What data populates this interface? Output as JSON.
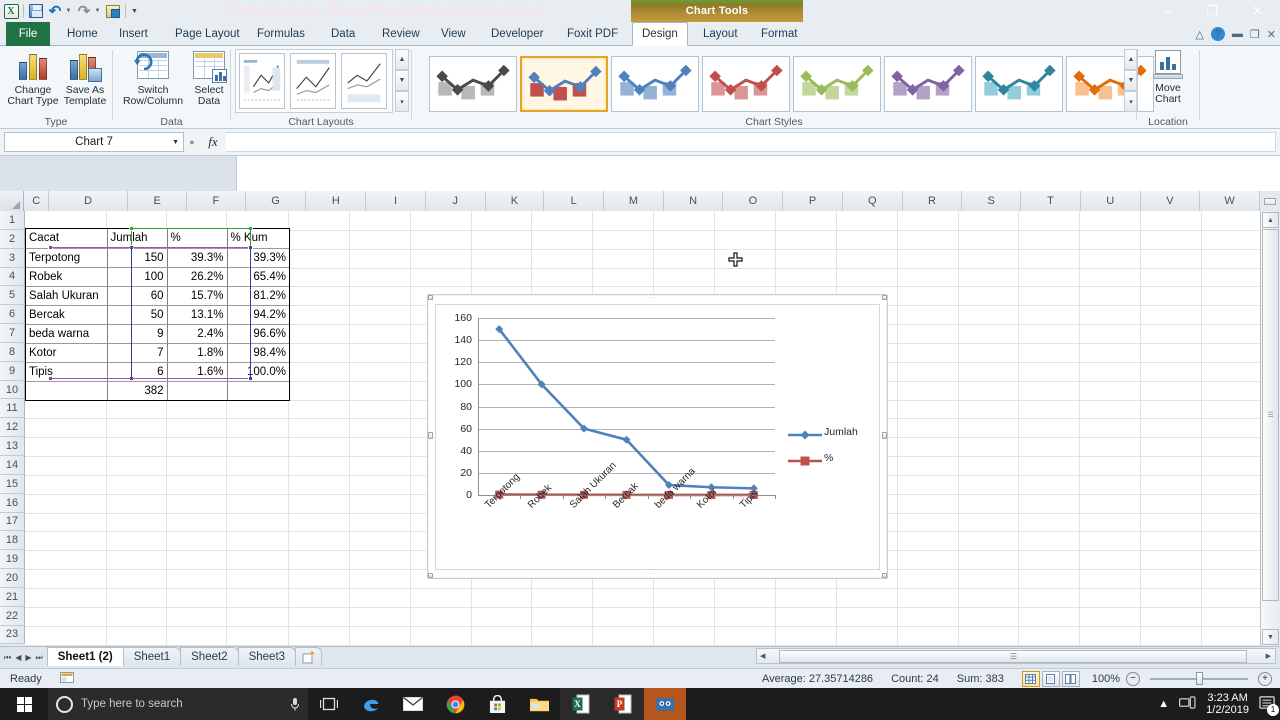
{
  "window": {
    "title": "Pareto Chart.xlsx  -  Microsoft Excel (Product Activation Failed)",
    "contextual_tab_group": "Chart Tools",
    "minimize": "–",
    "restore": "❐",
    "close": "✕",
    "accent_red": "#e81123",
    "excel_green": "#217346"
  },
  "quick_access": {
    "app_icon": "X",
    "items": [
      "save-icon",
      "undo-icon",
      "redo-icon",
      "print-preview-icon",
      "customize-qat-icon"
    ]
  },
  "ribbon": {
    "tabs": [
      "File",
      "Home",
      "Insert",
      "Page Layout",
      "Formulas",
      "Data",
      "Review",
      "View",
      "Developer",
      "Foxit PDF"
    ],
    "contextual_tabs": [
      "Design",
      "Layout",
      "Format"
    ],
    "active_tab": "Design",
    "help_icons": [
      "minimize-ribbon-icon",
      "help-icon",
      "restore-window-icon",
      "minimize-window-icon",
      "close-window-icon"
    ],
    "groups": [
      {
        "name": "Type",
        "buttons": [
          {
            "label_line1": "Change",
            "label_line2": "Chart Type",
            "icon": "change-chart-type-icon"
          },
          {
            "label_line1": "Save As",
            "label_line2": "Template",
            "icon": "save-as-template-icon"
          }
        ]
      },
      {
        "name": "Data",
        "buttons": [
          {
            "label_line1": "Switch",
            "label_line2": "Row/Column",
            "icon": "switch-row-column-icon"
          },
          {
            "label_line1": "Select",
            "label_line2": "Data",
            "icon": "select-data-icon"
          }
        ]
      },
      {
        "name": "Chart Layouts",
        "buttons": []
      },
      {
        "name": "Chart Styles",
        "buttons": []
      },
      {
        "name": "Location",
        "buttons": [
          {
            "label_line1": "Move",
            "label_line2": "Chart",
            "icon": "move-chart-icon"
          }
        ]
      }
    ],
    "chart_styles": [
      {
        "id": "style-1",
        "color": "#4a4a4a",
        "alt": "#b8b8b8",
        "selected": false
      },
      {
        "id": "style-2",
        "color": "#4f81bd",
        "alt": "#c0504d",
        "selected": true
      },
      {
        "id": "style-3",
        "color": "#4f81bd",
        "alt": "#95b3d7",
        "selected": false
      },
      {
        "id": "style-4",
        "color": "#c0504d",
        "alt": "#d99694",
        "selected": false
      },
      {
        "id": "style-5",
        "color": "#9bbb59",
        "alt": "#c3d69b",
        "selected": false
      },
      {
        "id": "style-6",
        "color": "#8064a2",
        "alt": "#b3a2c7",
        "selected": false
      },
      {
        "id": "style-7",
        "color": "#4bacc6",
        "alt": "#92cddc",
        "selected": false
      },
      {
        "id": "style-8",
        "color": "#f79646",
        "alt": "#fac090",
        "selected": false
      }
    ]
  },
  "formula_bar": {
    "name_box_value": "Chart 7",
    "fx_label": "fx",
    "formula_value": ""
  },
  "grid": {
    "columns": [
      "C",
      "D",
      "E",
      "F",
      "G",
      "H",
      "I",
      "J",
      "K",
      "L",
      "M",
      "N",
      "O",
      "P",
      "Q",
      "R",
      "S",
      "T",
      "U",
      "V",
      "W"
    ],
    "rows": [
      1,
      2,
      3,
      4,
      5,
      6,
      7,
      8,
      9,
      10,
      11,
      12,
      13,
      14,
      15,
      16,
      17,
      18,
      19,
      20,
      21,
      22,
      23
    ]
  },
  "table": {
    "headers": [
      "Cacat",
      "Jumlah",
      "%",
      "% Kum"
    ],
    "rows": [
      [
        "Terpotong",
        "150",
        "39.3%",
        "39.3%"
      ],
      [
        "Robek",
        "100",
        "26.2%",
        "65.4%"
      ],
      [
        "Salah Ukuran",
        "60",
        "15.7%",
        "81.2%"
      ],
      [
        "Bercak",
        "50",
        "13.1%",
        "94.2%"
      ],
      [
        "beda warna",
        "9",
        "2.4%",
        "96.6%"
      ],
      [
        "Kotor",
        "7",
        "1.8%",
        "98.4%"
      ],
      [
        "Tipis",
        "6",
        "1.6%",
        "100.0%"
      ]
    ],
    "total_row": [
      "",
      "382",
      "",
      ""
    ]
  },
  "chart_data": {
    "type": "line",
    "title": "",
    "xlabel": "",
    "ylabel": "",
    "categories": [
      "Terpotong",
      "Robek",
      "Salah Ukuran",
      "Bercak",
      "beda warna",
      "Kotor",
      "Tipis"
    ],
    "series": [
      {
        "name": "Jumlah",
        "color": "#4f81bd",
        "marker": "diamond",
        "values": [
          150,
          100,
          60,
          50,
          9,
          7,
          6
        ]
      },
      {
        "name": "%",
        "color": "#c0504d",
        "marker": "square",
        "values": [
          0.393,
          0.262,
          0.157,
          0.131,
          0.024,
          0.018,
          0.016
        ]
      }
    ],
    "yticks": [
      0,
      20,
      40,
      60,
      80,
      100,
      120,
      140,
      160
    ],
    "ylim": [
      0,
      160
    ],
    "grid": true,
    "legend": "right"
  },
  "sheet_tabs": {
    "tabs": [
      "Sheet1 (2)",
      "Sheet1",
      "Sheet2",
      "Sheet3"
    ],
    "active": "Sheet1 (2)",
    "insert_sheet_icon": "insert-worksheet-icon",
    "nav_first": "⏮",
    "nav_prev": "◀",
    "nav_next": "▶",
    "nav_last": "⏭"
  },
  "status_bar": {
    "mode": "Ready",
    "macro_icon": "record-macro-icon",
    "average": "Average: 27.35714286",
    "count": "Count: 24",
    "sum": "Sum: 383",
    "view_buttons": [
      "normal-view-icon",
      "page-layout-view-icon",
      "page-break-preview-icon"
    ],
    "zoom": "100%",
    "zoom_out": "−",
    "zoom_in": "+"
  },
  "taskbar": {
    "start": "start-button",
    "search_placeholder": "Type here to search",
    "mic_icon": "microphone-icon",
    "pinned": [
      "task-view-icon",
      "edge-icon",
      "mail-icon",
      "chrome-icon",
      "store-icon",
      "file-explorer-icon"
    ],
    "running": [
      "excel-icon",
      "powerpoint-icon",
      "screen-recorder-icon"
    ],
    "tray": [
      "show-hidden-icons-icon",
      "network-icon"
    ],
    "time": "3:23 AM",
    "date": "1/2/2019",
    "action_center": "action-center-icon",
    "notification_count": "1"
  },
  "cursor": {
    "type": "move-cursor"
  }
}
